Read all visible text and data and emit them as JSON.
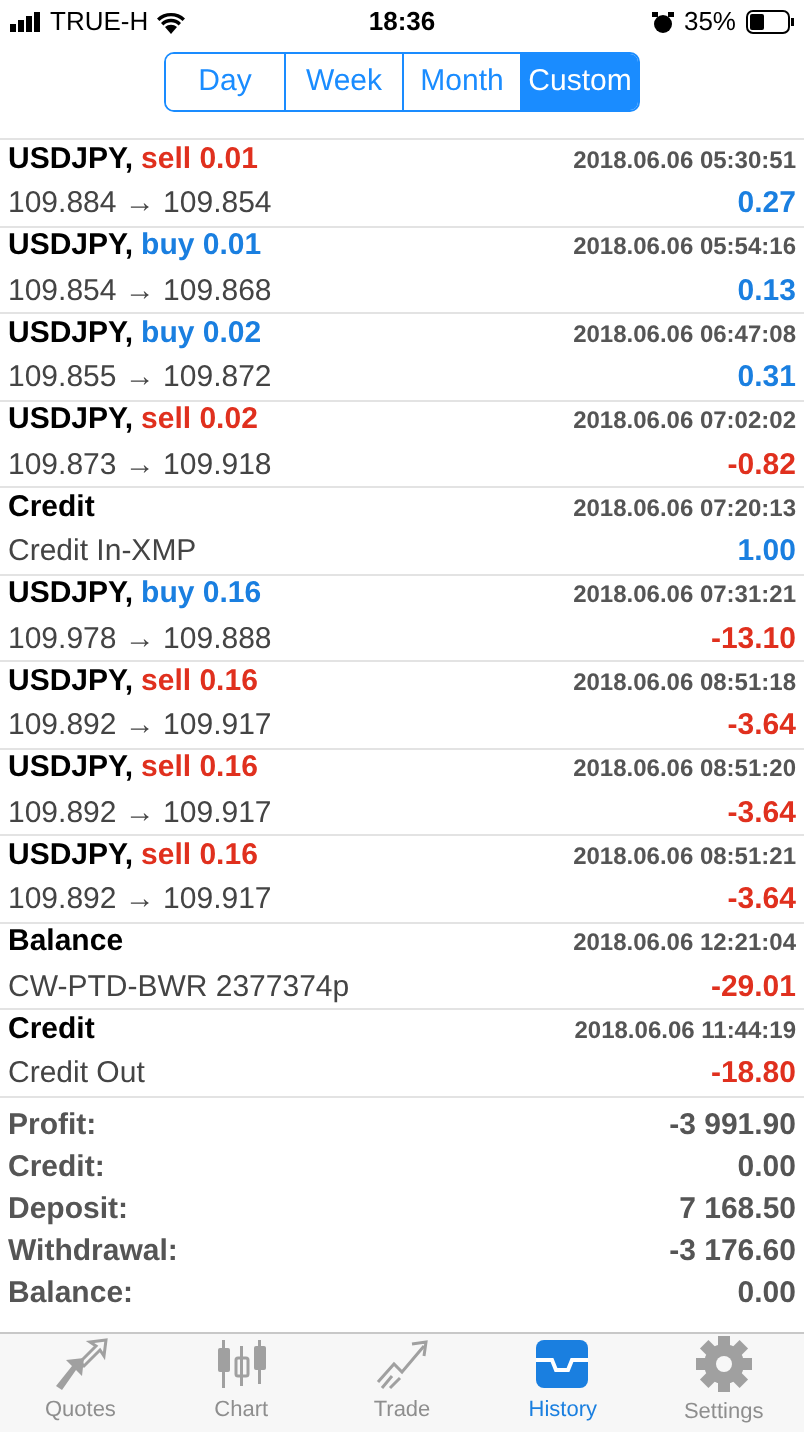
{
  "status_bar": {
    "carrier": "TRUE-H",
    "time": "18:36",
    "battery": "35%"
  },
  "period_tabs": [
    {
      "label": "Day",
      "selected": false
    },
    {
      "label": "Week",
      "selected": false
    },
    {
      "label": "Month",
      "selected": false
    },
    {
      "label": "Custom",
      "selected": true
    }
  ],
  "history": [
    {
      "kind": "trade",
      "symbol": "USDJPY,",
      "action": {
        "text": "sell 0.01",
        "color": "#e0301e"
      },
      "time": "2018.06.06 05:30:51",
      "detail": "109.884 → 109.854",
      "profit": {
        "text": "0.27",
        "color": "#1a7fe0"
      }
    },
    {
      "kind": "trade",
      "symbol": "USDJPY,",
      "action": {
        "text": "buy 0.01",
        "color": "#1a7fe0"
      },
      "time": "2018.06.06 05:54:16",
      "detail": "109.854 → 109.868",
      "profit": {
        "text": "0.13",
        "color": "#1a7fe0"
      }
    },
    {
      "kind": "trade",
      "symbol": "USDJPY,",
      "action": {
        "text": "buy 0.02",
        "color": "#1a7fe0"
      },
      "time": "2018.06.06 06:47:08",
      "detail": "109.855 → 109.872",
      "profit": {
        "text": "0.31",
        "color": "#1a7fe0"
      }
    },
    {
      "kind": "trade",
      "symbol": "USDJPY,",
      "action": {
        "text": "sell 0.02",
        "color": "#e0301e"
      },
      "time": "2018.06.06 07:02:02",
      "detail": "109.873 → 109.918",
      "profit": {
        "text": "-0.82",
        "color": "#e0301e"
      }
    },
    {
      "kind": "operation",
      "symbol": "Credit",
      "time": "2018.06.06 07:20:13",
      "detail": "Credit In-XMP",
      "profit": {
        "text": "1.00",
        "color": "#1a7fe0"
      }
    },
    {
      "kind": "trade",
      "symbol": "USDJPY,",
      "action": {
        "text": "buy 0.16",
        "color": "#1a7fe0"
      },
      "time": "2018.06.06 07:31:21",
      "detail": "109.978 → 109.888",
      "profit": {
        "text": "-13.10",
        "color": "#e0301e"
      }
    },
    {
      "kind": "trade",
      "symbol": "USDJPY,",
      "action": {
        "text": "sell 0.16",
        "color": "#e0301e"
      },
      "time": "2018.06.06 08:51:18",
      "detail": "109.892 → 109.917",
      "profit": {
        "text": "-3.64",
        "color": "#e0301e"
      }
    },
    {
      "kind": "trade",
      "symbol": "USDJPY,",
      "action": {
        "text": "sell 0.16",
        "color": "#e0301e"
      },
      "time": "2018.06.06 08:51:20",
      "detail": "109.892 → 109.917",
      "profit": {
        "text": "-3.64",
        "color": "#e0301e"
      }
    },
    {
      "kind": "trade",
      "symbol": "USDJPY,",
      "action": {
        "text": "sell 0.16",
        "color": "#e0301e"
      },
      "time": "2018.06.06 08:51:21",
      "detail": "109.892 → 109.917",
      "profit": {
        "text": "-3.64",
        "color": "#e0301e"
      }
    },
    {
      "kind": "operation",
      "symbol": "Balance",
      "time": "2018.06.06 12:21:04",
      "detail": "CW-PTD-BWR 2377374p",
      "profit": {
        "text": "-29.01",
        "color": "#e0301e"
      }
    },
    {
      "kind": "operation",
      "symbol": "Credit",
      "time": "2018.06.06 11:44:19",
      "detail": "Credit Out",
      "profit": {
        "text": "-18.80",
        "color": "#e0301e"
      }
    }
  ],
  "summary": [
    {
      "label": "Profit:",
      "value": "-3 991.90"
    },
    {
      "label": "Credit:",
      "value": "0.00"
    },
    {
      "label": "Deposit:",
      "value": "7 168.50"
    },
    {
      "label": "Withdrawal:",
      "value": "-3 176.60"
    },
    {
      "label": "Balance:",
      "value": "0.00"
    }
  ],
  "tab_bar": [
    {
      "label": "Quotes",
      "selected": false
    },
    {
      "label": "Chart",
      "selected": false
    },
    {
      "label": "Trade",
      "selected": false
    },
    {
      "label": "History",
      "selected": true
    },
    {
      "label": "Settings",
      "selected": false
    }
  ]
}
